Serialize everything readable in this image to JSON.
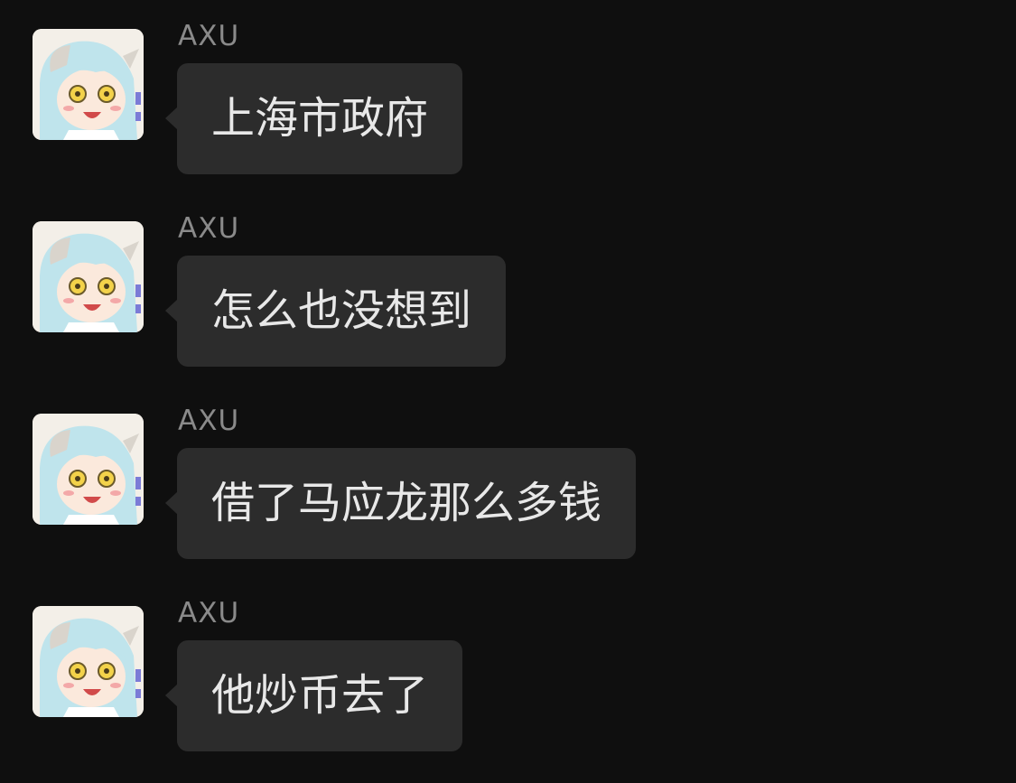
{
  "messages": [
    {
      "sender": "AXU",
      "text": "上海市政府",
      "avatar_icon": "anime-avatar-icon"
    },
    {
      "sender": "AXU",
      "text": "怎么也没想到",
      "avatar_icon": "anime-avatar-icon"
    },
    {
      "sender": "AXU",
      "text": "借了马应龙那么多钱",
      "avatar_icon": "anime-avatar-icon"
    },
    {
      "sender": "AXU",
      "text": "他炒币去了",
      "avatar_icon": "anime-avatar-icon"
    }
  ],
  "colors": {
    "background": "#0f0f0f",
    "bubble": "#2c2c2c",
    "bubble_text": "#e8e8e8",
    "sender_text": "#8a8a8a"
  }
}
